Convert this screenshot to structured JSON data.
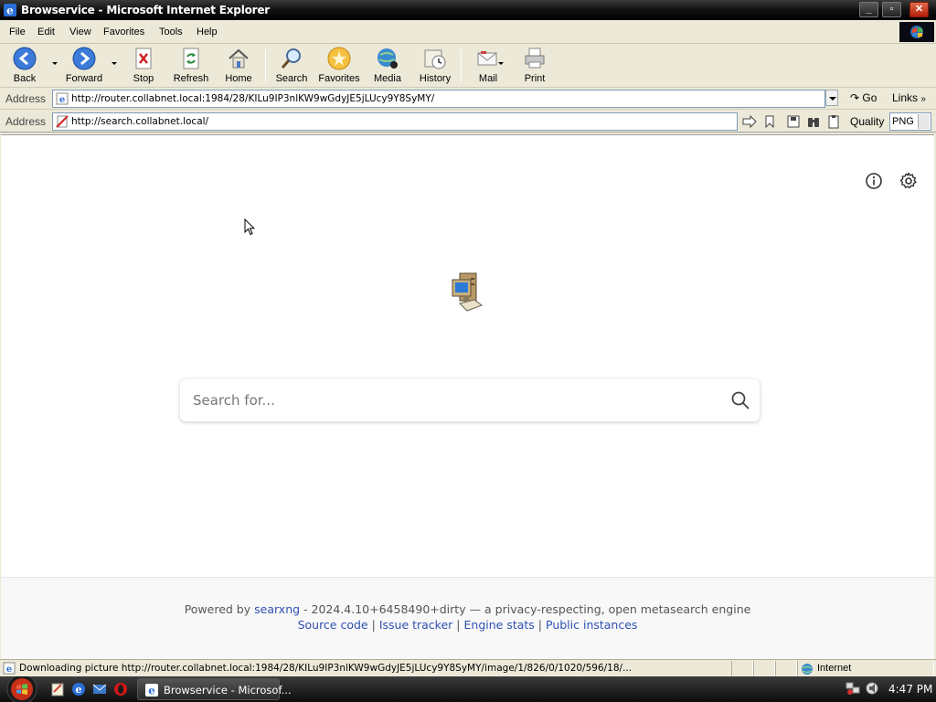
{
  "window": {
    "title": "Browservice - Microsoft Internet Explorer"
  },
  "menu": {
    "items": [
      "File",
      "Edit",
      "View",
      "Favorites",
      "Tools",
      "Help"
    ]
  },
  "toolbar": {
    "back": "Back",
    "forward": "Forward",
    "stop": "Stop",
    "refresh": "Refresh",
    "home": "Home",
    "search": "Search",
    "favorites": "Favorites",
    "media": "Media",
    "history": "History",
    "mail": "Mail",
    "print": "Print"
  },
  "address_bar": {
    "label": "Address",
    "url": "http://router.collabnet.local:1984/28/KILu9IP3nlKW9wGdyJE5jLUcy9Y8SyMY/",
    "go": "Go",
    "links": "Links"
  },
  "browservice_bar": {
    "label": "Address",
    "url": "http://search.collabnet.local/",
    "quality_label": "Quality",
    "quality_value": "PNG"
  },
  "page": {
    "search_placeholder": "Search for...",
    "footer": {
      "powered_by": "Powered by",
      "engine_name": "searxng",
      "version_text": "- 2024.4.10+6458490+dirty — a privacy-respecting, open metasearch engine",
      "links": [
        "Source code",
        "Issue tracker",
        "Engine stats",
        "Public instances"
      ],
      "separator": "|"
    }
  },
  "status_bar": {
    "text": "Downloading picture http://router.collabnet.local:1984/28/KILu9IP3nlKW9wGdyJE5jLUcy9Y8SyMY/image/1/826/0/1020/596/18/...",
    "zone": "Internet"
  },
  "taskbar": {
    "task_label": "Browservice - Microsof...",
    "clock": "4:47 PM"
  },
  "colors": {
    "chrome_bg": "#ece9d8",
    "link_blue": "#3050b0",
    "titlebar_black": "#000000"
  }
}
